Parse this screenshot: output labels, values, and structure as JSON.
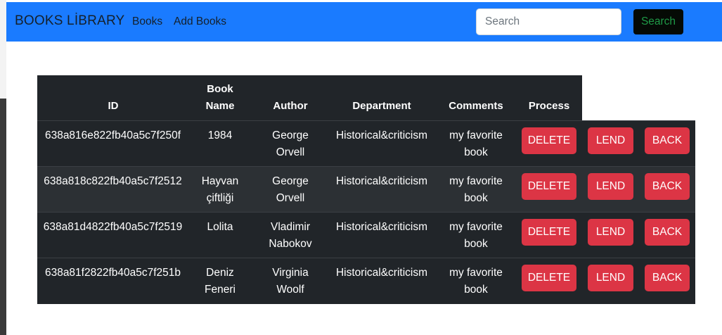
{
  "navbar": {
    "brand": "BOOKS LİBRARY",
    "links": [
      "Books",
      "Add Books"
    ],
    "search": {
      "placeholder": "Search",
      "value": "",
      "button_label": "Search"
    }
  },
  "colors": {
    "navbar_bg": "#1a7bff",
    "table_bg": "#212529",
    "table_stripe": "#2c3034",
    "danger": "#dc3545",
    "search_button_bg": "#050a05",
    "search_button_text": "#1f9a47"
  },
  "table": {
    "headers": [
      "ID",
      "Book Name",
      "Author",
      "Department",
      "Comments",
      "Process"
    ],
    "action_labels": {
      "delete": "DELETE",
      "lend": "LEND",
      "back": "BACK"
    },
    "rows": [
      {
        "id": "638a816e822fb40a5c7f250f",
        "name_lines": [
          "1984",
          ""
        ],
        "author_lines": [
          "George",
          "Orvell"
        ],
        "department": "Historical&criticism",
        "comment_lines": [
          "my favorite",
          "book"
        ]
      },
      {
        "id": "638a818c822fb40a5c7f2512",
        "name_lines": [
          "Hayvan",
          "çiftliği"
        ],
        "author_lines": [
          "George",
          "Orvell"
        ],
        "department": "Historical&criticism",
        "comment_lines": [
          "my favorite",
          "book"
        ]
      },
      {
        "id": "638a81d4822fb40a5c7f2519",
        "name_lines": [
          "Lolita",
          ""
        ],
        "author_lines": [
          "Vladimir",
          "Nabokov"
        ],
        "department": "Historical&criticism",
        "comment_lines": [
          "my favorite",
          "book"
        ]
      },
      {
        "id": "638a81f2822fb40a5c7f251b",
        "name_lines": [
          "Deniz",
          "Feneri"
        ],
        "author_lines": [
          "Virginia",
          "Woolf"
        ],
        "department": "Historical&criticism",
        "comment_lines": [
          "my favorite",
          "book"
        ]
      }
    ]
  }
}
